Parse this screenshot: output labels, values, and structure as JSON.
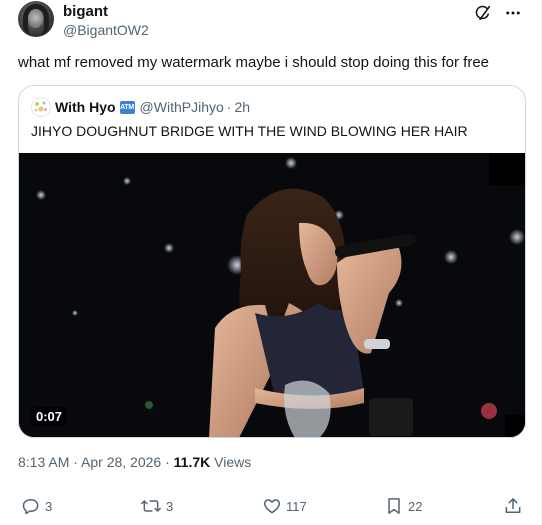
{
  "author": {
    "display_name": "bigant",
    "handle": "@BigantOW2"
  },
  "tweet": {
    "text": "what mf removed my watermark maybe i should stop doing this for free"
  },
  "quoted": {
    "display_name": "With Hyo",
    "badge": "ATM",
    "handle": "@WithPJihyo",
    "separator": "·",
    "time": "2h",
    "text": "JIHYO DOUGHNUT BRIDGE WITH THE WIND BLOWING HER HAIR",
    "video_duration": "0:07"
  },
  "meta": {
    "timestamp": "8:13 AM · Apr 28, 2026 · ",
    "views_count": "11.7K",
    "views_label": " Views"
  },
  "actions": {
    "replies": "3",
    "reposts": "3",
    "likes": "117",
    "bookmarks": "22"
  },
  "icons": {
    "header": [
      "grok-icon",
      "more-icon"
    ],
    "actions": [
      "reply-icon",
      "repost-icon",
      "like-icon",
      "bookmark-icon",
      "share-icon"
    ]
  },
  "colors": {
    "text": "#0f1419",
    "secondary": "#536471",
    "border": "#cfd9de",
    "badge": "#3b82d6"
  }
}
